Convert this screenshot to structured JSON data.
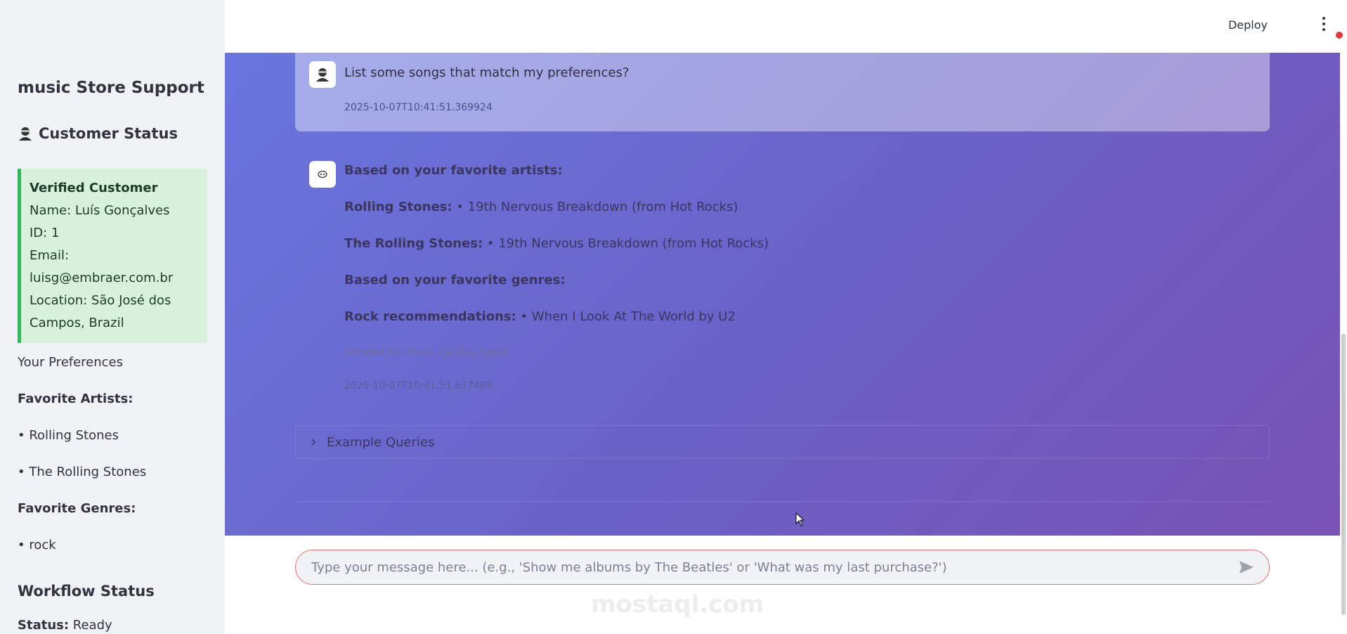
{
  "sidebar": {
    "title": "music Store Support",
    "customer_status_heading": "Customer Status",
    "customer_card": {
      "verified": "Verified Customer",
      "name_line": "Name: Luís Gonçalves",
      "id_line": "ID: 1",
      "email_label": "Email:",
      "email_value": "luisg@embraer.com.br",
      "location_line1": "Location: São José dos",
      "location_line2": "Campos, Brazil"
    },
    "preferences_label": "Your Preferences",
    "favorite_artists_label": "Favorite Artists:",
    "artists": [
      "• Rolling Stones",
      "• The Rolling Stones"
    ],
    "favorite_genres_label": "Favorite Genres:",
    "genres": [
      "• rock"
    ],
    "workflow_heading": "Workflow Status",
    "status_label": "Status:",
    "status_value": "Ready"
  },
  "header": {
    "deploy_label": "Deploy"
  },
  "messages": {
    "user": {
      "text": "List some songs that match my preferences?",
      "timestamp": "2025-10-07T10:41:51.369924"
    },
    "assistant": {
      "lines": [
        {
          "bold": "Based on your favorite artists:",
          "rest": ""
        },
        {
          "bold": "Rolling Stones:",
          "rest": " • 19th Nervous Breakdown (from Hot Rocks)"
        },
        {
          "bold": "The Rolling Stones:",
          "rest": " • 19th Nervous Breakdown (from Hot Rocks)"
        },
        {
          "bold": "Based on your favorite genres:",
          "rest": ""
        },
        {
          "bold": "Rock recommendations:",
          "rest": " • When I Look At The World by U2"
        }
      ],
      "handled_by": "Handled by: Music Catalog Agent",
      "timestamp": "2025-10-07T10:41:51.617499"
    }
  },
  "expander": {
    "label": "Example Queries"
  },
  "chat_input": {
    "placeholder": "Type your message here... (e.g., 'Show me albums by The Beatles' or 'What was my last purchase?')"
  },
  "watermark": {
    "text": "mostaql.com"
  },
  "colors": {
    "accent_green": "#21c354",
    "input_border": "#e57373",
    "gradient_start": "#6a76de",
    "gradient_end": "#7852b4"
  }
}
